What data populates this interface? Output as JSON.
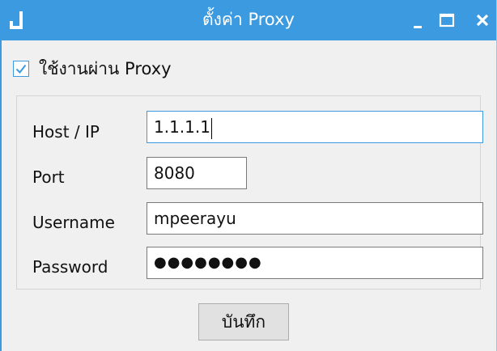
{
  "window": {
    "title": "ตั้งค่า Proxy"
  },
  "proxy": {
    "use_proxy_label": "ใช้งานผ่าน Proxy",
    "use_proxy_checked": true
  },
  "form": {
    "host_label": "Host / IP",
    "host_value": "1.1.1.1",
    "port_label": "Port",
    "port_value": "8080",
    "username_label": "Username",
    "username_value": "mpeerayu",
    "password_label": "Password",
    "password_value": "●●●●●●●●"
  },
  "actions": {
    "save_label": "บันทึก"
  },
  "colors": {
    "titlebar": "#3b9ae0",
    "accent": "#3b9ae0"
  }
}
